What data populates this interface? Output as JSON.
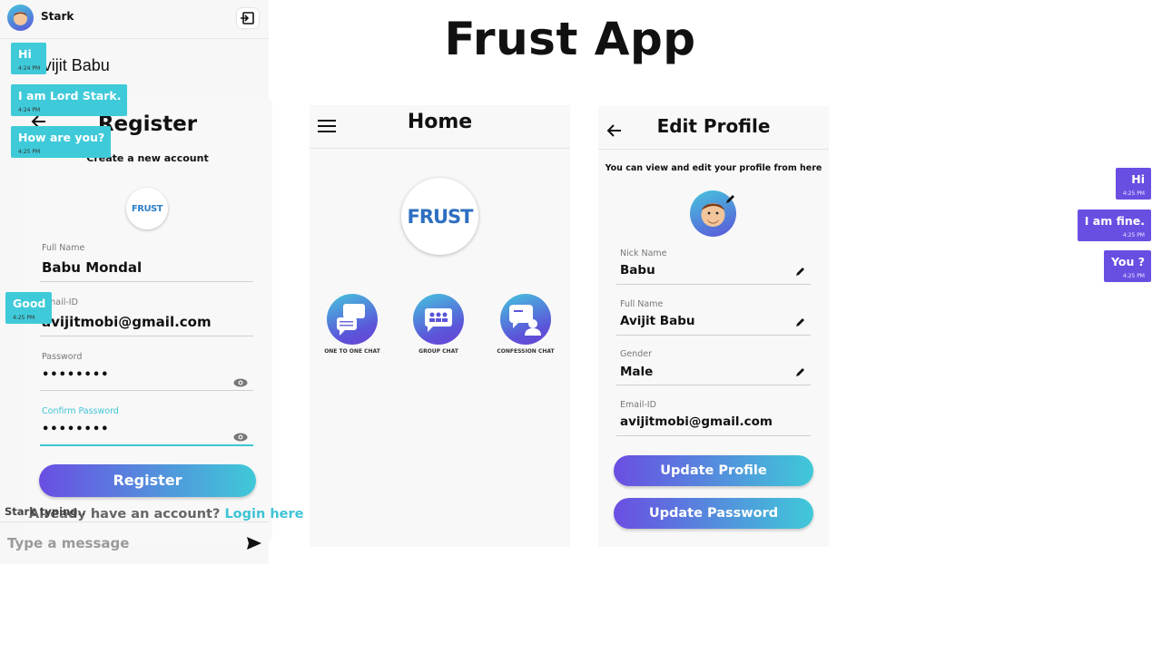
{
  "page": {
    "title": "Frust App",
    "byline": "By Avijit Babu"
  },
  "register": {
    "back_icon": "arrow-left-icon",
    "title": "Register",
    "subtitle": "Create a new account",
    "logo_text": "FRUST",
    "fields": [
      {
        "label": "Full Name",
        "value": "Babu Mondal"
      },
      {
        "label": "Email-ID",
        "value": "avijitmobi@gmail.com"
      },
      {
        "label": "Password",
        "value": "••••••••"
      },
      {
        "label": "Confirm Password",
        "value": "••••••••"
      }
    ],
    "button": "Register",
    "already_text": "Already have an account?",
    "login_link": "Login here",
    "accent_color": "#3fc4d5"
  },
  "home": {
    "menu_icon": "hamburger-icon",
    "title": "Home",
    "logo_text": "FRUST",
    "options": [
      {
        "label": "ONE TO ONE CHAT",
        "icon": "chat-bubbles-icon"
      },
      {
        "label": "GROUP CHAT",
        "icon": "group-chat-icon"
      },
      {
        "label": "CONFESSION CHAT",
        "icon": "confession-chat-icon"
      }
    ]
  },
  "edit": {
    "title": "Edit Profile",
    "subtitle": "You can view and edit your profile from here",
    "fields": [
      {
        "label": "Nick Name",
        "value": "Babu"
      },
      {
        "label": "Full Name",
        "value": "Avijit Babu"
      },
      {
        "label": "Gender",
        "value": "Male"
      },
      {
        "label": "Email-ID",
        "value": "avijitmobi@gmail.com"
      }
    ],
    "update_profile": "Update Profile",
    "update_password": "Update Password"
  },
  "chat": {
    "contact": "Stark",
    "messages": [
      {
        "text": "Hi",
        "time": "4:24 PM",
        "dir": "in"
      },
      {
        "text": "I am Lord Stark.",
        "time": "4:24 PM",
        "dir": "in"
      },
      {
        "text": "How are you?",
        "time": "4:25 PM",
        "dir": "in"
      },
      {
        "text": "Hi",
        "time": "4:25 PM",
        "dir": "out"
      },
      {
        "text": "I am fine.",
        "time": "4:25 PM",
        "dir": "out"
      },
      {
        "text": "You ?",
        "time": "4:25 PM",
        "dir": "out"
      },
      {
        "text": "Good",
        "time": "4:25 PM",
        "dir": "in"
      }
    ],
    "typing": "Stark typing..",
    "placeholder": "Type a message",
    "incoming_color": "#3fcad9",
    "outgoing_color": "#6a4ee2"
  }
}
